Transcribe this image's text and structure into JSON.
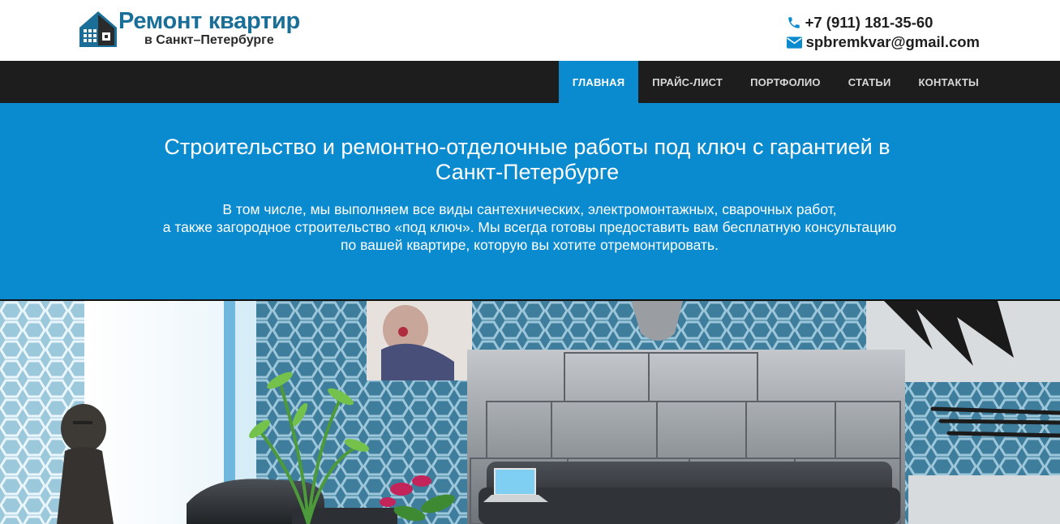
{
  "header": {
    "logo": {
      "title": "Ремонт квартир",
      "subtitle": "в Санкт–Петербурге",
      "icon": "house-icon"
    },
    "phone": {
      "icon": "phone-icon",
      "text": "+7 (911) 181-35-60"
    },
    "email": {
      "icon": "envelope-icon",
      "text": "spbremkvar@gmail.com"
    }
  },
  "nav": {
    "items": [
      {
        "label": "Главная",
        "active": true
      },
      {
        "label": "Прайс-лист",
        "active": false
      },
      {
        "label": "Портфолио",
        "active": false
      },
      {
        "label": "Статьи",
        "active": false
      },
      {
        "label": "Контакты",
        "active": false
      }
    ]
  },
  "hero": {
    "title_line1": "Строительство и ремонтно-отделочные работы под ключ с гарантией в",
    "title_line2": "Санкт-Петербурге",
    "text_line1": "В том числе, мы выполняем все виды сантехнических, электромонтажных, сварочных работ,",
    "text_line2": "а также загородное строительство «под ключ». Мы всегда готовы предоставить вам бесплатную консультацию",
    "text_line3": "по вашей квартире, которую вы хотите отремонтировать."
  },
  "colors": {
    "accent": "#0a8bd0",
    "nav_bg": "#1d1d1d",
    "logo_blue": "#1a6f98"
  }
}
